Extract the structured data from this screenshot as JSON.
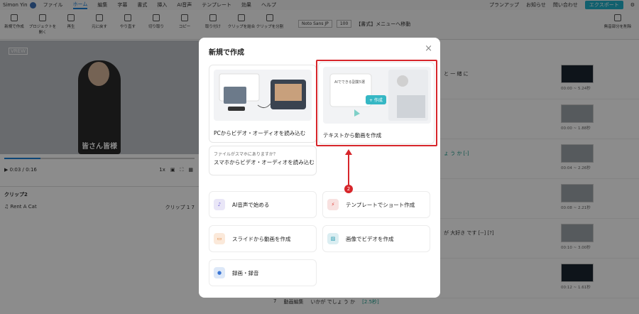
{
  "menubar": {
    "user": "Simon Yin",
    "items": [
      "ファイル",
      "ホーム",
      "編集",
      "字幕",
      "書式",
      "挿入",
      "AI音声",
      "テンプレート",
      "効果",
      "ヘルプ"
    ],
    "active_index": 1,
    "right": [
      "プランアップ",
      "お知らせ",
      "問い合わせ",
      "エクスポート"
    ]
  },
  "toolbar": {
    "buttons": [
      "新規で作成",
      "プロジェクトを開く",
      "再生",
      "元に戻す",
      "やり直す",
      "切り取り",
      "コピー",
      "取り付け",
      "クリップを結合",
      "クリップを分割"
    ],
    "font": "Noto Sans JP",
    "font_size": "100",
    "format_menu": "【書式】メニューへ移動",
    "right_button": "無音部分を削除"
  },
  "player": {
    "watermark": "VREW",
    "subtitle": "皆さん皆様",
    "time": "0:03 / 0:16",
    "speed": "1x",
    "progress": 0.19
  },
  "clips": {
    "title": "クリップ2",
    "track_name": "Rent A Cat",
    "track_right": "クリップ 1 7"
  },
  "right_pane": {
    "rows": [
      {
        "text": "と 一 緒 に",
        "time": "00:00 ~ 5.24秒",
        "dark": true
      },
      {
        "text": "",
        "time": "00:00 ~ 1.88秒",
        "dark": false
      },
      {
        "text": "ょ う か [-]",
        "time": "00:04 ~ 2.26秒",
        "dark": false
      },
      {
        "text": "",
        "time": "00:08 ~ 2.21秒",
        "dark": false
      },
      {
        "text": "が 大好き です [--] [?]",
        "time": "00:10 ~ 3.00秒",
        "dark": false
      },
      {
        "text": "",
        "time": "00:12 ~ 1.61秒",
        "dark": true
      }
    ],
    "bottom_row": {
      "num": "7",
      "label": "動画編集",
      "text": "いかが でしょ う か",
      "tag": "[2.5秒]"
    }
  },
  "modal": {
    "title": "新規で作成",
    "cards": {
      "pc": "PCからビデオ・オーディオを読み込む",
      "text": "テキストから動画を作成",
      "text_badge": "+ 作成",
      "text_balloon": "AIでできる副業5選",
      "phone_sub": "ファイルがスマホにありますか？",
      "phone": "スマホからビデオ・オーディオを読み込む"
    },
    "options": [
      {
        "label": "AI音声で始める",
        "icon": "ai-voice-icon",
        "color": "#e9e6f7"
      },
      {
        "label": "テンプレートでショート作成",
        "icon": "template-icon",
        "color": "#f8e1e0"
      },
      {
        "label": "スライドから動画を作成",
        "icon": "slide-icon",
        "color": "#fbe9da"
      },
      {
        "label": "画像でビデオを作成",
        "icon": "image-icon",
        "color": "#dbeef2"
      },
      {
        "label": "録画・録音",
        "icon": "record-icon",
        "color": "#dde8f8"
      }
    ]
  },
  "annotation": {
    "step": "2",
    "color": "#d7262b"
  }
}
